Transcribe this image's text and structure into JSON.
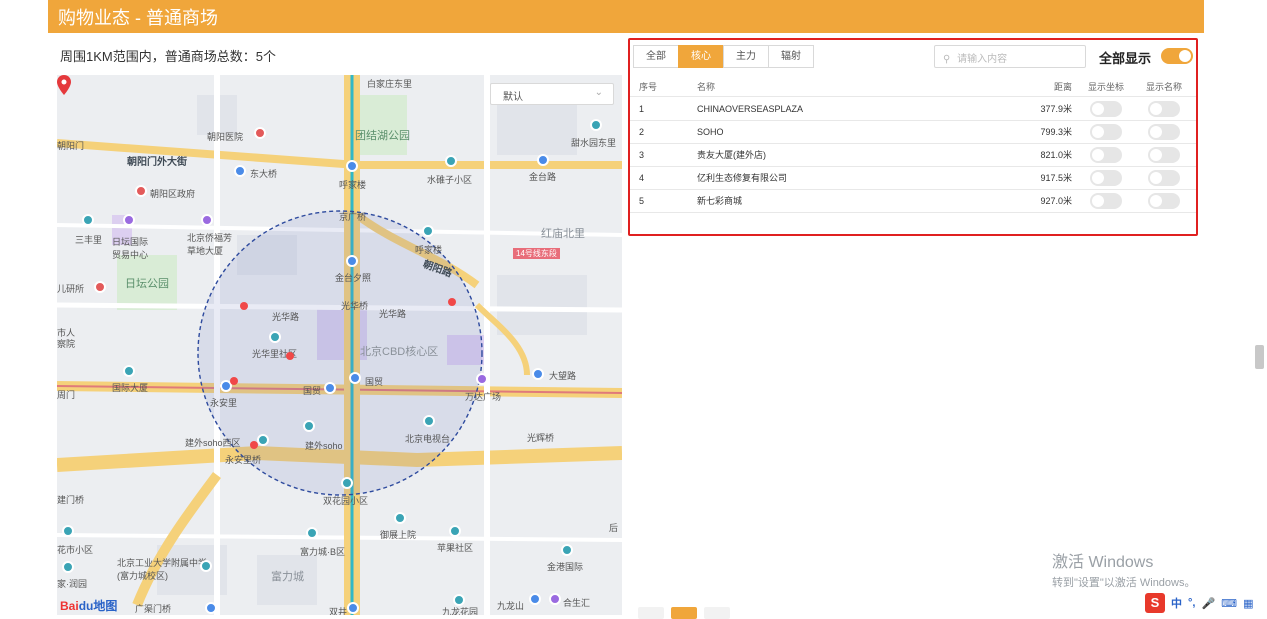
{
  "header": {
    "title": "购物业态 - 普通商场"
  },
  "summary": {
    "text": "周围1KM范围内，普通商场总数：5个"
  },
  "map": {
    "select_value": "默认",
    "labels": {
      "l1": "白家庄东里",
      "l2": "朝阳医院",
      "l3": "团结湖公园",
      "l4": "朝阳门外大街",
      "l5": "东大桥",
      "l6": "呼家楼",
      "l7": "水碓子小区",
      "l8": "金台路",
      "l9": "甜水园东里",
      "l10": "朝阳区政府",
      "l11": "京广桥",
      "l12": "三丰里",
      "l13": "日坛国际贸易中心",
      "l14": "北京侨福芳草地大厦",
      "l15": "呼家楼",
      "l16": "红庙北里",
      "l17": "14号线东段",
      "l18": "日坛公园",
      "l19": "朝阳路",
      "l20": "金台夕照",
      "l21": "光华桥",
      "l22": "光华路",
      "l23": "光华路",
      "l24": "光华里社区",
      "l25": "北京CBD核心区",
      "l26": "国际大厦",
      "l27": "国贸",
      "l28": "国贸",
      "l29": "大望路",
      "l30": "永安里",
      "l31": "万达广场",
      "l32": "建外soho西区",
      "l33": "建外soho",
      "l34": "北京电视台",
      "l35": "光辉桥",
      "l36": "永安里桥",
      "l37": "双花园小区",
      "l38": "御展上院",
      "l39": "苹果社区",
      "l40": "富力城·B区",
      "l41": "金港国际",
      "l42": "北京工业大学附属中学(富力城校区)",
      "l43": "富力城",
      "l44": "九龙山",
      "l45": "合生汇",
      "l46": "双井",
      "l47": "九龙花园",
      "l48": "广渠门桥",
      "l49": "朝阳门",
      "l50": "儿研所",
      "l51": "市人",
      "l52": "察院",
      "l53": "建门桥",
      "l54": "后",
      "l55": "花市小区",
      "l56": "家·润园",
      "l57": "周门"
    },
    "logo_bai": "Bai",
    "logo_du": "du地图"
  },
  "panel": {
    "tabs": [
      {
        "label": "全部",
        "active": false
      },
      {
        "label": "核心",
        "active": true
      },
      {
        "label": "主力",
        "active": false
      },
      {
        "label": "辐射",
        "active": false
      }
    ],
    "search_placeholder": "请输入内容",
    "show_all_label": "全部显示",
    "show_all_on": true,
    "columns": {
      "no": "序号",
      "name": "名称",
      "distance": "距离",
      "show_coord": "显示坐标",
      "show_name": "显示名称"
    },
    "rows": [
      {
        "no": "1",
        "name": "CHINAOVERSEASPLAZA",
        "distance": "377.9米"
      },
      {
        "no": "2",
        "name": "SOHO",
        "distance": "799.3米"
      },
      {
        "no": "3",
        "name": "贵友大厦(建外店)",
        "distance": "821.0米"
      },
      {
        "no": "4",
        "name": "亿利生态修复有限公司",
        "distance": "917.5米"
      },
      {
        "no": "5",
        "name": "新七彩商城",
        "distance": "927.0米"
      }
    ]
  },
  "watermark": {
    "line1": "激活 Windows",
    "line2": "转到\"设置\"以激活 Windows。"
  },
  "ime": {
    "logo": "S",
    "mode": "中"
  },
  "colors": {
    "accent": "#f0a63b",
    "highlight_border": "#e02020"
  }
}
